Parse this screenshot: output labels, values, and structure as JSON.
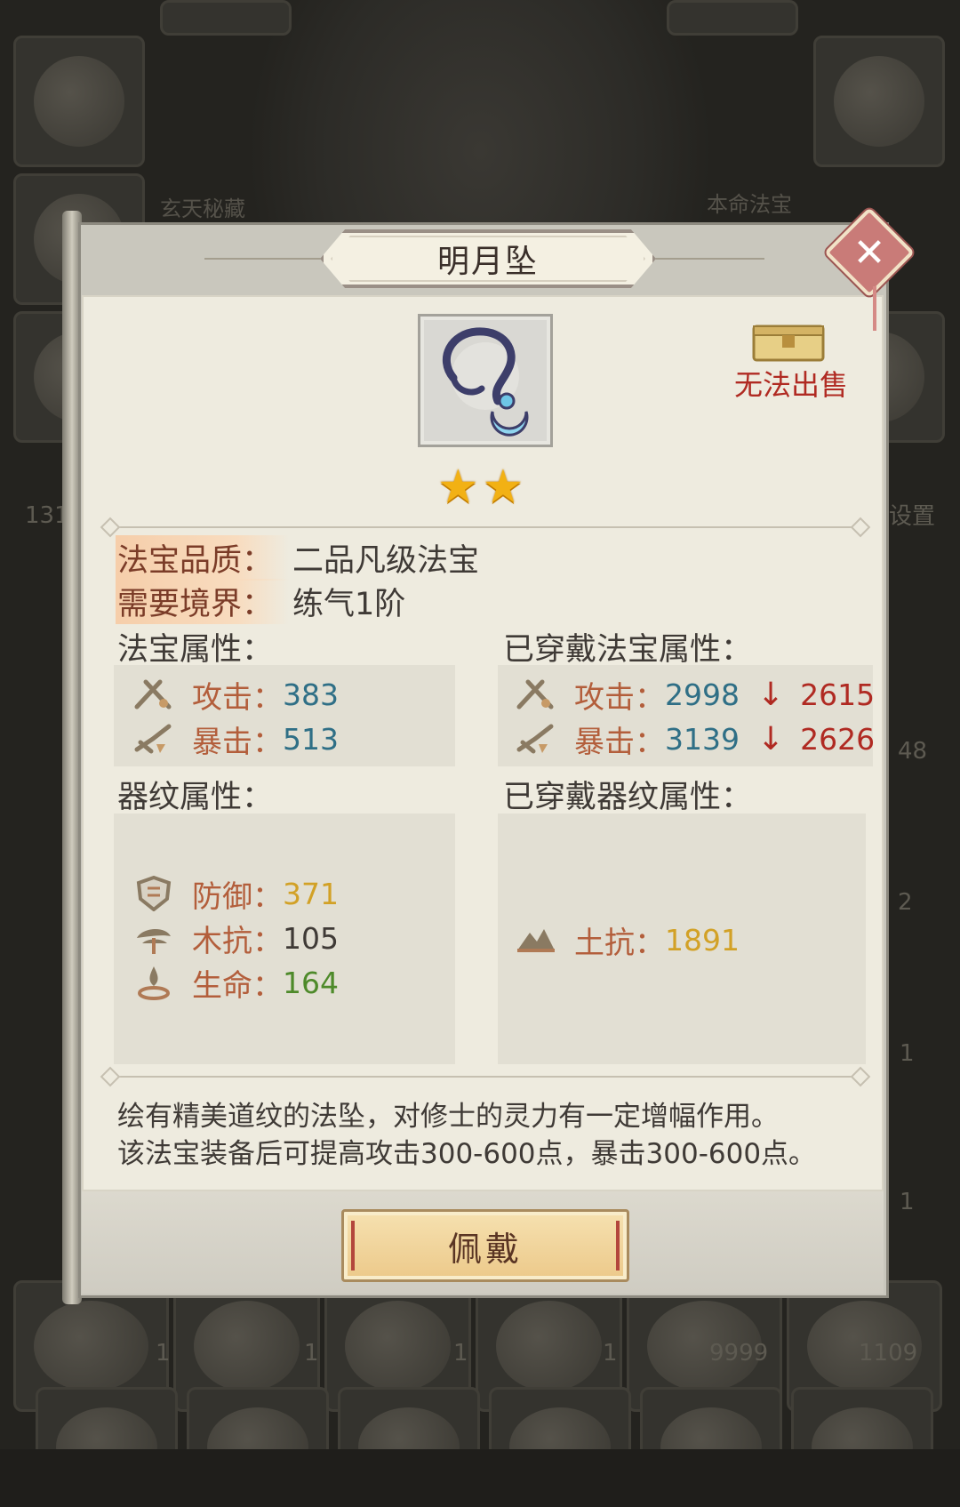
{
  "background": {
    "labels": [
      "玄天秘藏",
      "本命法宝"
    ],
    "left_number": "131",
    "right_label": "设置",
    "counts": [
      "48",
      "2",
      "1",
      "1",
      "1",
      "1",
      "1",
      "1",
      "9999",
      "1109"
    ]
  },
  "dialog": {
    "title": "明月坠",
    "close_icon": "close-x-icon",
    "item_icon": "pendant-icon",
    "sell_icon": "treasure-chest-icon",
    "sell_status": "无法出售",
    "star_count": 2,
    "star_glyph": "★",
    "quality_label": "法宝品质：",
    "quality_value": "二品凡级法宝",
    "realm_label": "需要境界：",
    "realm_value": "练气1阶",
    "item_stats_title": "法宝属性：",
    "equipped_stats_title": "已穿戴法宝属性：",
    "item_stats": [
      {
        "icon": "attack-icon",
        "name": "攻击：",
        "value": "383"
      },
      {
        "icon": "crit-icon",
        "name": "暴击：",
        "value": "513"
      }
    ],
    "equipped_stats": [
      {
        "icon": "attack-icon",
        "name": "攻击：",
        "value": "2998",
        "arrow": "↓",
        "diff": "2615"
      },
      {
        "icon": "crit-icon",
        "name": "暴击：",
        "value": "3139",
        "arrow": "↓",
        "diff": "2626"
      }
    ],
    "pattern_title": "器纹属性：",
    "equipped_pattern_title": "已穿戴器纹属性：",
    "pattern_stats": [
      {
        "icon": "defense-icon",
        "name": "防御：",
        "value": "371"
      },
      {
        "icon": "wood-resist-icon",
        "name": "木抗：",
        "value": "105"
      },
      {
        "icon": "life-icon",
        "name": "生命：",
        "value": "164"
      }
    ],
    "equipped_pattern_stats": [
      {
        "icon": "earth-resist-icon",
        "name": "土抗：",
        "value": "1891"
      }
    ],
    "description_1": "绘有精美道纹的法坠，对修士的灵力有一定增幅作用。",
    "description_2": "该法宝装备后可提高攻击300-600点，暴击300-600点。",
    "wear_button": "佩戴",
    "colors": {
      "accent_red": "#b02a22",
      "stat_name": "#b35e3b",
      "value_blue": "#2f6f86",
      "value_gold": "#d2a126",
      "value_green": "#4e8a2a",
      "star": "#f2b114"
    }
  }
}
